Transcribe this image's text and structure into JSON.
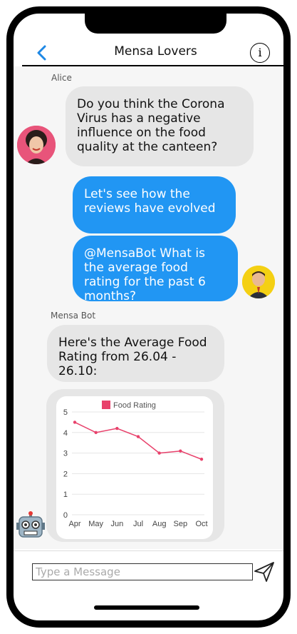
{
  "header": {
    "title": "Mensa Lovers",
    "info_label": "i"
  },
  "messages": [
    {
      "sender": "Alice",
      "text": "Do you think the Corona Virus has a negative influence on the food quality at the canteen?"
    },
    {
      "text": "Let's see how the reviews have evolved"
    },
    {
      "text": "@MensaBot What is the average food rating for the past 6 months?"
    },
    {
      "sender": "Mensa Bot",
      "text": "Here's the Average Food Rating from 26.04 - 26.10:"
    }
  ],
  "chart_data": {
    "type": "line",
    "categories": [
      "Apr",
      "May",
      "Jun",
      "Jul",
      "Aug",
      "Sep",
      "Oct"
    ],
    "series": [
      {
        "name": "Food Rating",
        "values": [
          4.5,
          4.0,
          4.2,
          3.8,
          3.0,
          3.1,
          2.7
        ]
      }
    ],
    "ylim": [
      0,
      5
    ],
    "yticks": [
      0,
      1,
      2,
      3,
      4,
      5
    ],
    "grid": true,
    "legend": "top",
    "color": "#e8416b"
  },
  "input": {
    "placeholder": "Type a Message"
  },
  "colors": {
    "outgoing_bubble": "#2196f3",
    "incoming_bubble": "#e6e6e6",
    "accent": "#1e88e5"
  }
}
